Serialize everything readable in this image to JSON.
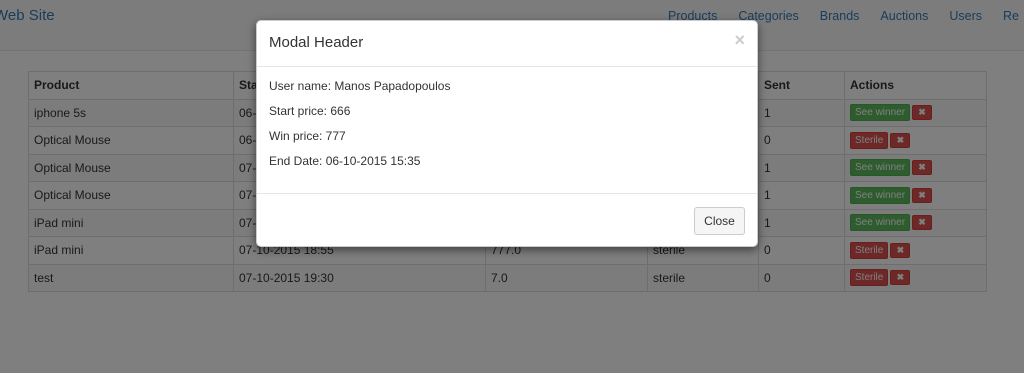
{
  "navbar": {
    "brand": "Web Site",
    "links": [
      "Products",
      "Categories",
      "Brands",
      "Auctions",
      "Users",
      "Re"
    ]
  },
  "table": {
    "headers": [
      "Product",
      "Sta",
      "",
      "",
      "Sent",
      "Actions"
    ],
    "rows": [
      {
        "product": "iphone 5s",
        "start": "06-",
        "price": "",
        "status": "",
        "sent": "1",
        "action": "See winner",
        "action_type": "success"
      },
      {
        "product": "Optical Mouse",
        "start": "06-",
        "price": "",
        "status": "",
        "sent": "0",
        "action": "Sterile",
        "action_type": "danger"
      },
      {
        "product": "Optical Mouse",
        "start": "07-",
        "price": "",
        "status": "",
        "sent": "1",
        "action": "See winner",
        "action_type": "success"
      },
      {
        "product": "Optical Mouse",
        "start": "07-",
        "price": "",
        "status": "",
        "sent": "1",
        "action": "See winner",
        "action_type": "success"
      },
      {
        "product": "iPad mini",
        "start": "07-",
        "price": "",
        "status": "",
        "sent": "1",
        "action": "See winner",
        "action_type": "success"
      },
      {
        "product": "iPad mini",
        "start": "07-10-2015 18:55",
        "price": "777.0",
        "status": "sterile",
        "sent": "0",
        "action": "Sterile",
        "action_type": "danger"
      },
      {
        "product": "test",
        "start": "07-10-2015 19:30",
        "price": "7.0",
        "status": "sterile",
        "sent": "0",
        "action": "Sterile",
        "action_type": "danger"
      }
    ],
    "delete_glyph": "✖"
  },
  "modal": {
    "title": "Modal Header",
    "close_glyph": "×",
    "lines": [
      "User name: Manos Papadopoulos",
      "Start price: 666",
      "Win price: 777",
      "End Date: 06-10-2015 15:35"
    ],
    "close_button": "Close"
  }
}
